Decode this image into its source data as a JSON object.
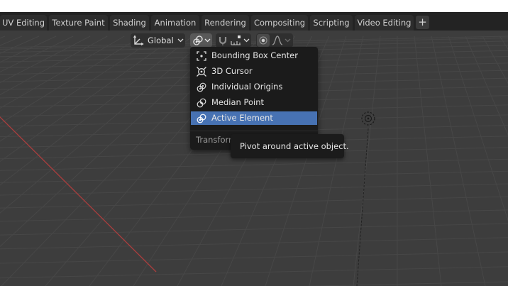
{
  "workspace_tabs": [
    {
      "label": "UV Editing"
    },
    {
      "label": "Texture Paint"
    },
    {
      "label": "Shading"
    },
    {
      "label": "Animation"
    },
    {
      "label": "Rendering"
    },
    {
      "label": "Compositing"
    },
    {
      "label": "Scripting"
    },
    {
      "label": "Video Editing"
    }
  ],
  "add_tab_label": "+",
  "header": {
    "orientation_label": "Global"
  },
  "pivot_menu": {
    "items": [
      {
        "label": "Bounding Box Center",
        "icon": "bounding-box-center-icon"
      },
      {
        "label": "3D Cursor",
        "icon": "3d-cursor-icon"
      },
      {
        "label": "Individual Origins",
        "icon": "individual-origins-icon"
      },
      {
        "label": "Median Point",
        "icon": "median-point-icon"
      },
      {
        "label": "Active Element",
        "icon": "active-element-icon"
      }
    ],
    "selected_index": 4,
    "footer_label": "Transform Pivot Point"
  },
  "tooltip": {
    "text": "Pivot around active object."
  },
  "colors": {
    "selected": "#4772b3",
    "x_axis": "#a63e3e",
    "menu_bg": "#1b1b1b"
  }
}
